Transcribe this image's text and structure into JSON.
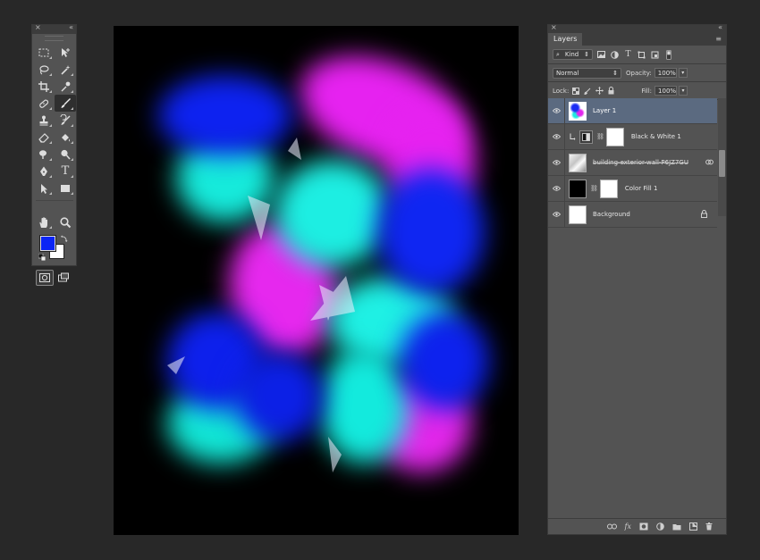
{
  "colors": {
    "foreground": "#0b25f5",
    "background": "#ffffff",
    "selected_layer": "#5b6a80",
    "panel": "#535353"
  },
  "tools": {
    "close_glyph": "×",
    "collapse_glyph": "«",
    "items": [
      {
        "name": "rectangular-marquee-icon"
      },
      {
        "name": "move-icon"
      },
      {
        "name": "lasso-icon"
      },
      {
        "name": "magic-wand-icon"
      },
      {
        "name": "crop-icon"
      },
      {
        "name": "eyedropper-icon"
      },
      {
        "name": "spot-healing-icon"
      },
      {
        "name": "brush-icon",
        "active": true
      },
      {
        "name": "clone-stamp-icon"
      },
      {
        "name": "history-brush-icon"
      },
      {
        "name": "eraser-icon"
      },
      {
        "name": "paint-bucket-icon"
      },
      {
        "name": "smudge-icon"
      },
      {
        "name": "dodge-icon"
      },
      {
        "name": "pen-icon"
      },
      {
        "name": "type-icon"
      },
      {
        "name": "path-selection-icon"
      },
      {
        "name": "rectangle-shape-icon"
      },
      {
        "name": "hand-icon"
      },
      {
        "name": "zoom-icon"
      }
    ],
    "type_glyph": "T"
  },
  "layers_panel": {
    "close_glyph": "×",
    "collapse_glyph": "«",
    "menu_glyph": "≡",
    "tab_label": "Layers",
    "filter": {
      "value": "Kind",
      "arrow": "⇕"
    },
    "blend_mode": {
      "value": "Normal",
      "arrow": "⇕"
    },
    "opacity": {
      "label": "Opacity:",
      "value": "100%",
      "arrow": "▾"
    },
    "lock_label": "Lock:",
    "fill": {
      "label": "Fill:",
      "value": "100%",
      "arrow": "▾"
    },
    "layers": [
      {
        "name": "Layer 1",
        "selected": true
      },
      {
        "name": "Black & White 1",
        "selected": false
      },
      {
        "name": "building-exterior-wall-P6JZ7GU",
        "selected": false
      },
      {
        "name": "Color Fill 1",
        "selected": false
      },
      {
        "name": "Background",
        "selected": false
      }
    ],
    "link_glyph": "⛓",
    "footer_icons": [
      "link-layers-icon",
      "fx-icon",
      "add-mask-icon",
      "adjustment-layer-icon",
      "new-group-icon",
      "new-layer-icon",
      "delete-layer-icon"
    ],
    "fx_label": "fx"
  }
}
